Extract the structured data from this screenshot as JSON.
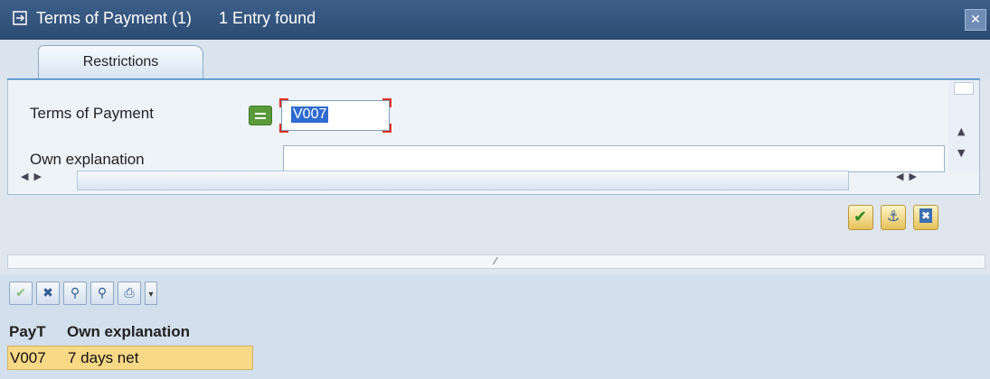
{
  "window": {
    "title": "Terms of Payment (1)",
    "status": "1 Entry found"
  },
  "tabs": [
    {
      "label": "Restrictions"
    }
  ],
  "form": {
    "terms_label": "Terms of Payment",
    "terms_value": "V007",
    "own_label": "Own explanation",
    "own_value": ""
  },
  "result": {
    "columns": [
      "PayT",
      "Own explanation"
    ],
    "rows": [
      {
        "payt": "V007",
        "explanation": "7 days net"
      }
    ]
  },
  "colors": {
    "titlebar": "#2c4b72",
    "selection": "#2f6bd0",
    "row_highlight": "#f9d886",
    "confirm_green": "#2f8a1f"
  }
}
